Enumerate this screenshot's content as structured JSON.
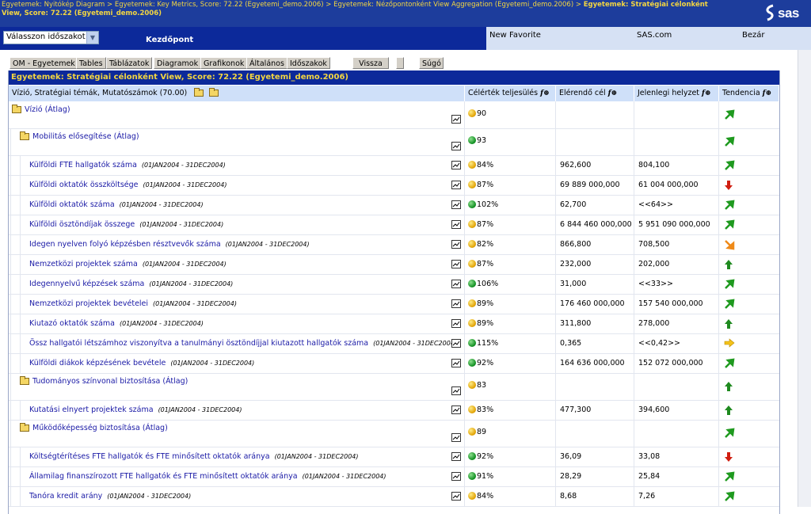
{
  "breadcrumb": {
    "items": [
      "Egyetemek: Nyitókép Diagram",
      "Egyetemek: Key Metrics, Score: 72.22 (Egyetemi_demo.2006)",
      "Egyetemek: Nézőpontonként View Aggregation (Egyetemi_demo.2006)"
    ],
    "current": "Egyetemek: Stratégiai célonként View, Score: 72.22 (Egyetemi_demo.2006)",
    "separator": " > "
  },
  "logo": {
    "text": "sas"
  },
  "period_select": {
    "value": "Válasszon időszakot"
  },
  "home_label": "Kezdőpont",
  "top_links": {
    "favorite": "New Favorite",
    "sas": "SAS.com",
    "close": "Bezár"
  },
  "toolbar": {
    "buttons": [
      "OM - Egyetemek",
      "Tables",
      "Táblázatok",
      "Diagramok",
      "Grafikonok",
      "Általános",
      "Időszakok"
    ],
    "back": "Vissza",
    "help": "Súgó"
  },
  "title": "Egyetemek: Stratégiai célonként View, Score: 72.22 (Egyetemi_demo.2006)",
  "headers": {
    "name": "Vízió, Stratégiai témák, Mutatószámok (70.00)",
    "completion": "Célérték teljesülés",
    "target": "Elérendő cél",
    "current": "Jelenlegi helyzet",
    "trend": "Tendencia",
    "fx": "f⊕"
  },
  "colors": {
    "header_bg": "#0c299a",
    "title_text": "#f3d641",
    "link": "#1a1aa6",
    "column_header_bg": "#cfe0f9"
  },
  "rows": [
    {
      "name": "Vízió (Átlag)",
      "period": "",
      "pct": "90",
      "target": "",
      "current": "",
      "bullet": "yellow",
      "trend": "up-right",
      "level": 0,
      "folder": true
    },
    {
      "name": "Mobilitás elősegítése (Átlag)",
      "period": "",
      "pct": "93",
      "target": "",
      "current": "",
      "bullet": "green",
      "trend": "up-right",
      "level": 1,
      "folder": true
    },
    {
      "name": "Külföldi FTE hallgatók száma",
      "period": "(01JAN2004 - 31DEC2004)",
      "pct": "84%",
      "target": "962,600",
      "current": "804,100",
      "bullet": "yellow",
      "trend": "up-right",
      "level": 2
    },
    {
      "name": "Külföldi oktatók összköltsége",
      "period": "(01JAN2004 - 31DEC2004)",
      "pct": "87%",
      "target": "69 889 000,000",
      "current": "61 004 000,000",
      "bullet": "yellow",
      "trend": "down",
      "level": 2
    },
    {
      "name": "Külföldi oktatók száma",
      "period": "(01JAN2004 - 31DEC2004)",
      "pct": "102%",
      "target": "62,700",
      "current": "<<64>>",
      "bullet": "green",
      "trend": "up-right",
      "level": 2
    },
    {
      "name": "Külföldi ösztöndíjak összege",
      "period": "(01JAN2004 - 31DEC2004)",
      "pct": "87%",
      "target": "6 844 460 000,000",
      "current": "5 951 090 000,000",
      "bullet": "yellow",
      "trend": "up-right",
      "level": 2
    },
    {
      "name": "Idegen nyelven folyó képzésben résztvevők száma",
      "period": "(01JAN2004 - 31DEC2004)",
      "pct": "82%",
      "target": "866,800",
      "current": "708,500",
      "bullet": "yellow",
      "trend": "down-right",
      "level": 2
    },
    {
      "name": "Nemzetközi projektek száma",
      "period": "(01JAN2004 - 31DEC2004)",
      "pct": "87%",
      "target": "232,000",
      "current": "202,000",
      "bullet": "yellow",
      "trend": "up",
      "level": 2
    },
    {
      "name": "Idegennyelvű képzések száma",
      "period": "(01JAN2004 - 31DEC2004)",
      "pct": "106%",
      "target": "31,000",
      "current": "<<33>>",
      "bullet": "green",
      "trend": "up-right",
      "level": 2
    },
    {
      "name": "Nemzetközi projektek bevételei",
      "period": "(01JAN2004 - 31DEC2004)",
      "pct": "89%",
      "target": "176 460 000,000",
      "current": "157 540 000,000",
      "bullet": "yellow",
      "trend": "up-right",
      "level": 2
    },
    {
      "name": "Kiutazó oktatók száma",
      "period": "(01JAN2004 - 31DEC2004)",
      "pct": "89%",
      "target": "311,800",
      "current": "278,000",
      "bullet": "yellow",
      "trend": "up",
      "level": 2
    },
    {
      "name": "Össz hallgatói létszámhoz viszonyítva a tanulmányi ösztöndíjjal kiutazott hallgatók száma",
      "period": "(01JAN2004 - 31DEC2004)",
      "pct": "115%",
      "target": "0,365",
      "current": "<<0,42>>",
      "bullet": "green",
      "trend": "right",
      "level": 2
    },
    {
      "name": "Külföldi diákok képzésének bevétele",
      "period": "(01JAN2004 - 31DEC2004)",
      "pct": "92%",
      "target": "164 636 000,000",
      "current": "152 072 000,000",
      "bullet": "green",
      "trend": "up-right",
      "level": 2
    },
    {
      "name": "Tudományos színvonal biztosítása (Átlag)",
      "period": "",
      "pct": "83",
      "target": "",
      "current": "",
      "bullet": "yellow",
      "trend": "up",
      "level": 1,
      "folder": true
    },
    {
      "name": "Kutatási elnyert projektek száma",
      "period": "(01JAN2004 - 31DEC2004)",
      "pct": "83%",
      "target": "477,300",
      "current": "394,600",
      "bullet": "yellow",
      "trend": "up",
      "level": 2
    },
    {
      "name": "Működőképesség biztosítása (Átlag)",
      "period": "",
      "pct": "89",
      "target": "",
      "current": "",
      "bullet": "yellow",
      "trend": "up-right",
      "level": 1,
      "folder": true
    },
    {
      "name": "Költségtérítéses FTE hallgatók és FTE minősített oktatók aránya",
      "period": "(01JAN2004 - 31DEC2004)",
      "pct": "92%",
      "target": "36,09",
      "current": "33,08",
      "bullet": "green",
      "trend": "down",
      "level": 2
    },
    {
      "name": "Államilag finanszírozott FTE hallgatók és FTE minősített oktatók aránya",
      "period": "(01JAN2004 - 31DEC2004)",
      "pct": "91%",
      "target": "28,29",
      "current": "25,84",
      "bullet": "green",
      "trend": "up-right",
      "level": 2
    },
    {
      "name": "Tanóra kredit arány",
      "period": "(01JAN2004 - 31DEC2004)",
      "pct": "84%",
      "target": "8,68",
      "current": "7,26",
      "bullet": "yellow",
      "trend": "up-right",
      "level": 2
    }
  ]
}
